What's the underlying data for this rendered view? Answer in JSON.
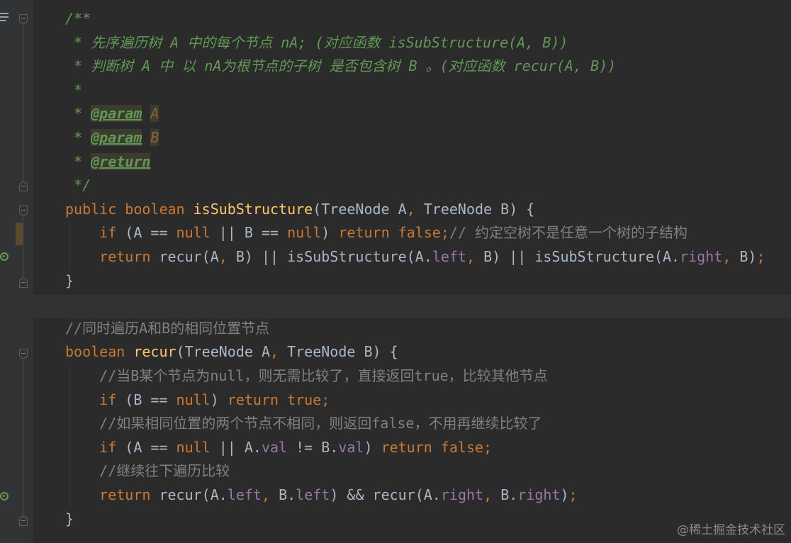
{
  "editor": {
    "lines": [
      {
        "segs": [
          [
            "doc",
            "/**"
          ]
        ]
      },
      {
        "segs": [
          [
            "doc",
            " * 先序遍历树 A 中的每个节点 nA; (对应函数 isSubStructure(A, B))"
          ]
        ]
      },
      {
        "segs": [
          [
            "doc",
            " * 判断树 A 中 以 nA为根节点的子树 是否包含树 B 。(对应函数 recur(A, B))"
          ]
        ]
      },
      {
        "segs": [
          [
            "doc",
            " *"
          ]
        ]
      },
      {
        "segs": [
          [
            "doc",
            " * "
          ],
          [
            "doctag",
            "@param"
          ],
          [
            "doc",
            " "
          ],
          [
            "docparam",
            "A"
          ]
        ]
      },
      {
        "segs": [
          [
            "doc",
            " * "
          ],
          [
            "doctag",
            "@param"
          ],
          [
            "doc",
            " "
          ],
          [
            "docparam",
            "B"
          ]
        ]
      },
      {
        "segs": [
          [
            "doc",
            " * "
          ],
          [
            "doctag",
            "@return"
          ]
        ]
      },
      {
        "segs": [
          [
            "doc",
            " */"
          ]
        ]
      },
      {
        "segs": [
          [
            "kw",
            "public boolean "
          ],
          [
            "fn",
            "isSubStructure"
          ],
          [
            "plain",
            "(TreeNode A"
          ],
          [
            "kw",
            ", "
          ],
          [
            "plain",
            "TreeNode B) {"
          ]
        ]
      },
      {
        "segs": [
          [
            "plain",
            "    "
          ],
          [
            "kw",
            "if "
          ],
          [
            "plain",
            "(A == "
          ],
          [
            "kw",
            "null"
          ],
          [
            "plain",
            " || B == "
          ],
          [
            "kw",
            "null"
          ],
          [
            "plain",
            ") "
          ],
          [
            "kw",
            "return false;"
          ],
          [
            "cmt",
            "// 约定空树不是任意一个树的子结构"
          ]
        ]
      },
      {
        "segs": [
          [
            "plain",
            "    "
          ],
          [
            "kw",
            "return "
          ],
          [
            "plain",
            "recur(A"
          ],
          [
            "kw",
            ", "
          ],
          [
            "plain",
            "B) || isSubStructure(A."
          ],
          [
            "field",
            "left"
          ],
          [
            "kw",
            ", "
          ],
          [
            "plain",
            "B) || isSubStructure(A."
          ],
          [
            "field",
            "right"
          ],
          [
            "kw",
            ", "
          ],
          [
            "plain",
            "B)"
          ],
          [
            "kw",
            ";"
          ]
        ]
      },
      {
        "segs": [
          [
            "plain",
            "}"
          ]
        ]
      },
      {
        "segs": []
      },
      {
        "segs": [
          [
            "cmt",
            "//同时遍历A和B的相同位置节点"
          ]
        ]
      },
      {
        "segs": [
          [
            "kw",
            "boolean "
          ],
          [
            "fn",
            "recur"
          ],
          [
            "plain",
            "(TreeNode A"
          ],
          [
            "kw",
            ", "
          ],
          [
            "plain",
            "TreeNode B) {"
          ]
        ]
      },
      {
        "segs": [
          [
            "plain",
            "    "
          ],
          [
            "cmt",
            "//当B某个节点为null，则无需比较了，直接返回true，比较其他节点"
          ]
        ]
      },
      {
        "segs": [
          [
            "plain",
            "    "
          ],
          [
            "kw",
            "if "
          ],
          [
            "plain",
            "(B == "
          ],
          [
            "kw",
            "null"
          ],
          [
            "plain",
            ") "
          ],
          [
            "kw",
            "return true;"
          ]
        ]
      },
      {
        "segs": [
          [
            "plain",
            "    "
          ],
          [
            "cmt",
            "//如果相同位置的两个节点不相同，则返回false，不用再继续比较了"
          ]
        ]
      },
      {
        "segs": [
          [
            "plain",
            "    "
          ],
          [
            "kw",
            "if "
          ],
          [
            "plain",
            "(A == "
          ],
          [
            "kw",
            "null"
          ],
          [
            "plain",
            " || A."
          ],
          [
            "field",
            "val"
          ],
          [
            "plain",
            " != B."
          ],
          [
            "field",
            "val"
          ],
          [
            "plain",
            ") "
          ],
          [
            "kw",
            "return false;"
          ]
        ]
      },
      {
        "segs": [
          [
            "plain",
            "    "
          ],
          [
            "cmt",
            "//继续往下遍历比较"
          ]
        ]
      },
      {
        "segs": [
          [
            "plain",
            "    "
          ],
          [
            "kw",
            "return "
          ],
          [
            "plain",
            "recur(A."
          ],
          [
            "field",
            "left"
          ],
          [
            "kw",
            ", "
          ],
          [
            "plain",
            "B."
          ],
          [
            "field",
            "left"
          ],
          [
            "plain",
            ") && recur(A."
          ],
          [
            "field",
            "right"
          ],
          [
            "kw",
            ", "
          ],
          [
            "plain",
            "B."
          ],
          [
            "field",
            "right"
          ],
          [
            "plain",
            ")"
          ],
          [
            "kw",
            ";"
          ]
        ]
      },
      {
        "segs": [
          [
            "plain",
            "}"
          ]
        ]
      }
    ]
  },
  "colors": {
    "background": "#2b2b2b",
    "keyword": "#cc7832",
    "function": "#ffc66d",
    "field": "#9876aa",
    "doc_comment": "#629755",
    "line_comment": "#808080",
    "text": "#a9b7c6"
  },
  "gutter_icons": [
    "structure-menu-icon",
    "fold-icon",
    "override-method-icon"
  ],
  "watermark": "@稀土掘金技术社区"
}
